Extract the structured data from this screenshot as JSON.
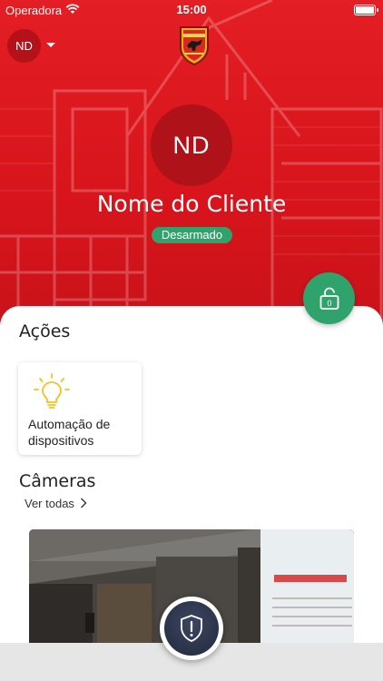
{
  "status_bar": {
    "carrier": "Operadora",
    "time": "15:00"
  },
  "header": {
    "account_initials": "ND",
    "logo_icon": "alarmatic-logo-icon"
  },
  "profile": {
    "initials": "ND",
    "name": "Nome do Cliente",
    "status": "Desarmado"
  },
  "lock_button": {
    "icon": "padlock-icon",
    "badge": "0"
  },
  "actions": {
    "title": "Ações",
    "items": [
      {
        "icon": "lightbulb-icon",
        "label": "Automação de dispositivos"
      }
    ]
  },
  "cameras": {
    "title": "Câmeras",
    "see_all": "Ver todas"
  },
  "panic_button": {
    "icon": "shield-alert-icon"
  },
  "colors": {
    "brand_red": "#e31e24",
    "green": "#2fa36b",
    "dark_navy": "#2a3248"
  }
}
